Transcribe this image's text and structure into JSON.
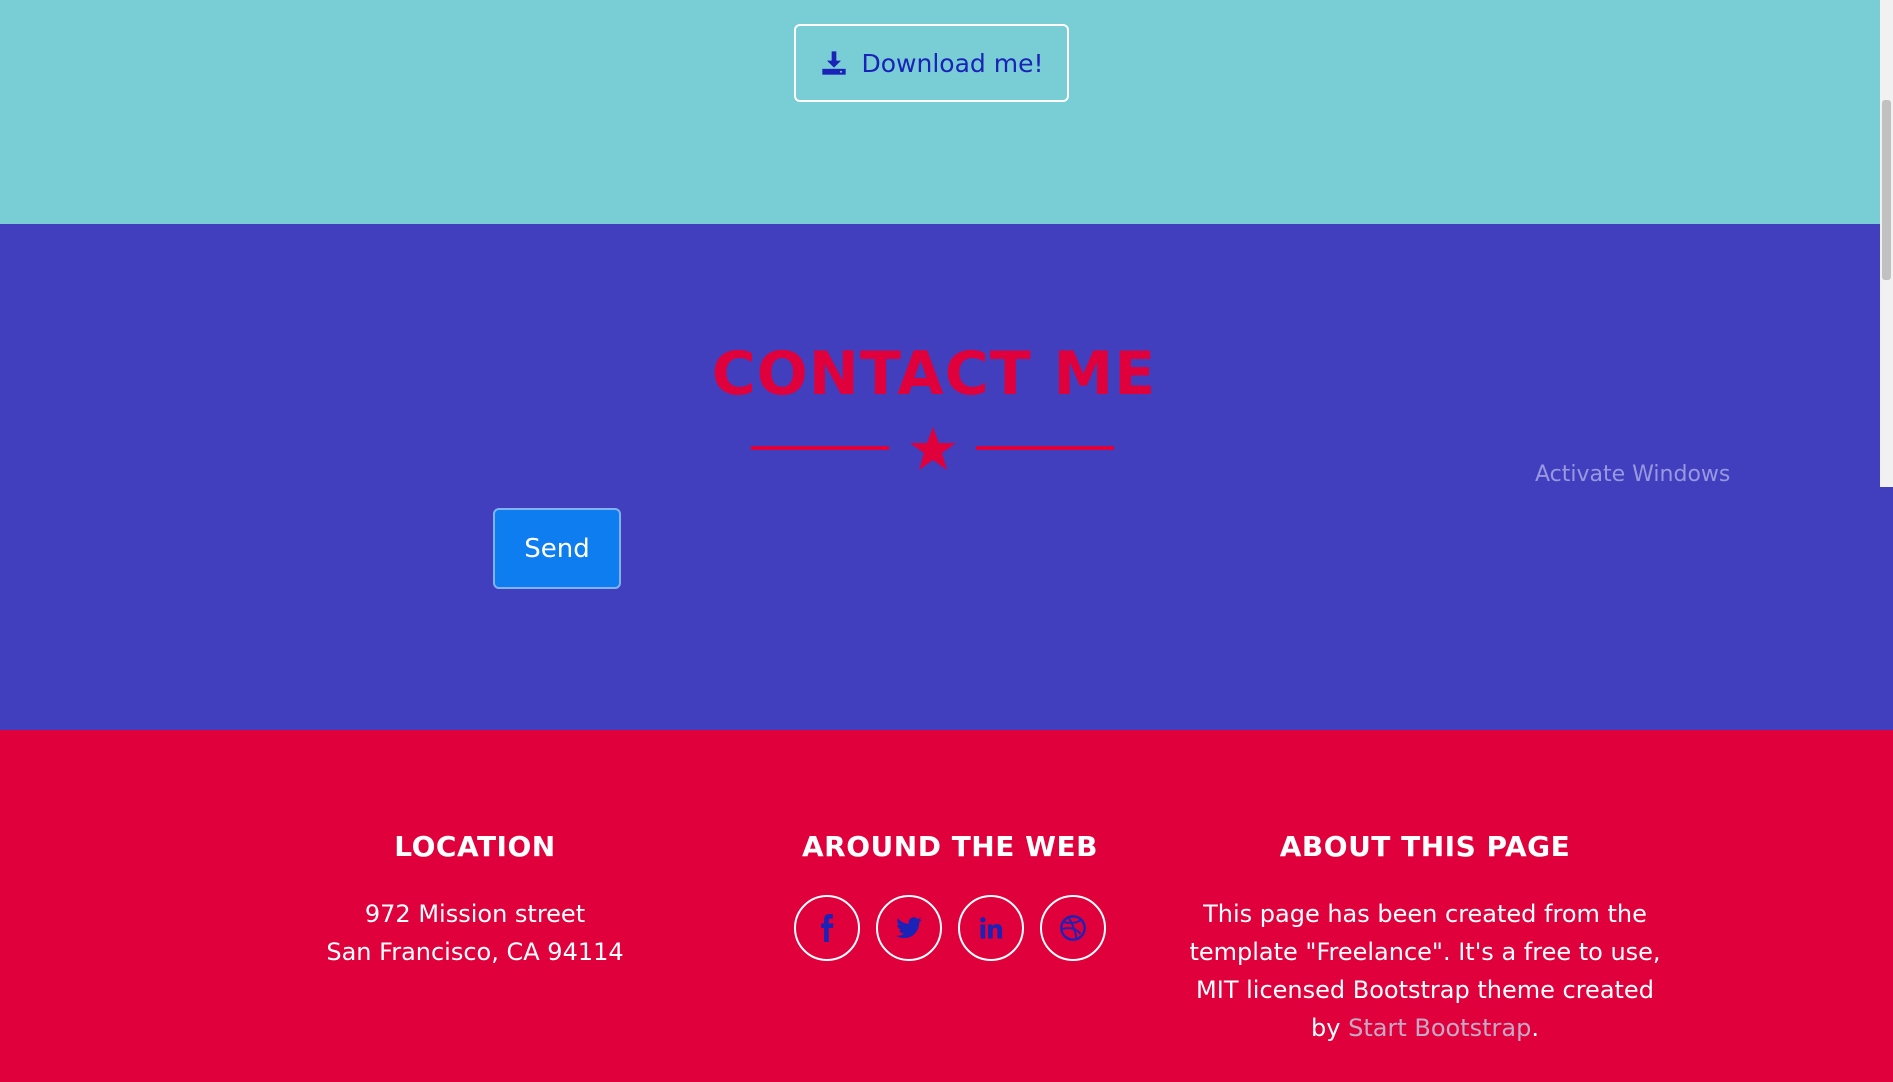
{
  "top": {
    "download_label": "Download me!",
    "download_icon": "download-icon"
  },
  "contact": {
    "title": "CONTACT ME",
    "divider_icon": "star-icon",
    "send_label": "Send",
    "watermark": "Activate Windows"
  },
  "footer": {
    "location": {
      "heading": "LOCATION",
      "line1": "972 Mission street",
      "line2": "San Francisco, CA 94114"
    },
    "web": {
      "heading": "AROUND THE WEB",
      "icons": [
        "facebook-icon",
        "twitter-icon",
        "linkedin-icon",
        "dribbble-icon"
      ]
    },
    "about": {
      "heading": "ABOUT THIS PAGE",
      "text": "This page has been created from the template \"Freelance\". It's a free to use, MIT licensed Bootstrap theme created by",
      "link": "Start Bootstrap",
      "suffix": "."
    }
  },
  "colors": {
    "top_bg": "#78ced4",
    "contact_bg": "#413fbe",
    "footer_bg": "#e0003b",
    "accent": "#e0003c",
    "icon_blue": "#1a22b8",
    "send_bg": "#0d7df0"
  }
}
